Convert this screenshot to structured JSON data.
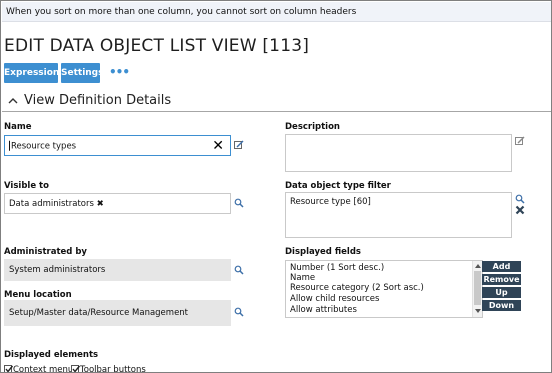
{
  "banner": {
    "text": "When you sort on more than one column, you cannot sort on column headers"
  },
  "page": {
    "title": "EDIT DATA OBJECT LIST VIEW [113]"
  },
  "toolbar": {
    "expressions_label": "Expressions",
    "settings_label": "Settings",
    "more_label": "•••"
  },
  "section": {
    "title": "View Definition Details",
    "icon": "chevron-up-icon"
  },
  "form": {
    "name": {
      "label": "Name",
      "value": "Resource types"
    },
    "description": {
      "label": "Description",
      "value": ""
    },
    "visible_to": {
      "label": "Visible to",
      "value": "Data administrators"
    },
    "data_object_type_filter": {
      "label": "Data object type filter",
      "value": "Resource type [60]"
    },
    "administrated_by": {
      "label": "Administrated by",
      "value": "System administrators"
    },
    "menu_location": {
      "label": "Menu location",
      "value": "Setup/Master data/Resource Management"
    },
    "displayed_fields": {
      "label": "Displayed fields",
      "items": [
        "Number (1 Sort desc.)",
        "Name",
        "Resource category (2 Sort asc.)",
        "Allow child resources",
        "Allow attributes"
      ],
      "buttons": {
        "add": "Add",
        "remove": "Remove",
        "up": "Up",
        "down": "Down"
      }
    },
    "displayed_elements": {
      "label": "Displayed elements",
      "context_menu": {
        "label": "Context menu",
        "checked": true
      },
      "toolbar_buttons": {
        "label": "Toolbar buttons",
        "checked": true
      }
    }
  },
  "colors": {
    "accent": "#3d8fd1",
    "button_dark": "#2f4457",
    "readonly_bg": "#e6e6e6"
  }
}
